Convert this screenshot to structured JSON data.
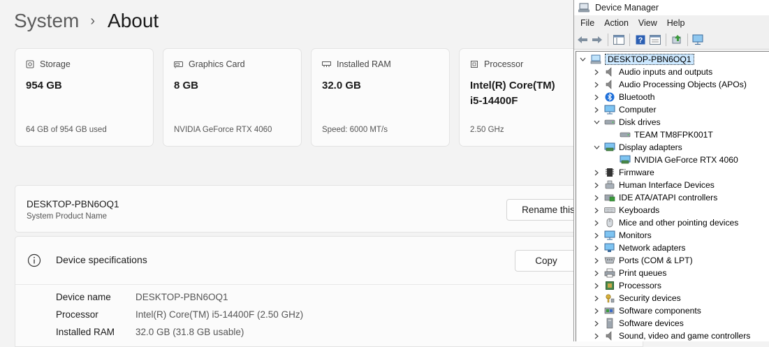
{
  "settings": {
    "breadcrumb": {
      "parent": "System",
      "separator": "›",
      "current": "About"
    },
    "cards": [
      {
        "title": "Storage",
        "value": "954 GB",
        "sub": "64 GB of 954 GB used",
        "icon": "storage-icon"
      },
      {
        "title": "Graphics Card",
        "value": "8 GB",
        "sub": "NVIDIA GeForce RTX 4060",
        "icon": "graphics-card-icon"
      },
      {
        "title": "Installed RAM",
        "value": "32.0 GB",
        "sub": "Speed: 6000 MT/s",
        "icon": "ram-icon"
      },
      {
        "title": "Processor",
        "value_line1": "Intel(R) Core(TM)",
        "value_line2": "i5-14400F",
        "sub": "2.50 GHz",
        "icon": "processor-icon"
      }
    ],
    "pc": {
      "name": "DESKTOP-PBN6OQ1",
      "sub": "System Product Name",
      "rename_label": "Rename this"
    },
    "specs": {
      "title": "Device specifications",
      "copy_label": "Copy",
      "rows": [
        {
          "label": "Device name",
          "value": "DESKTOP-PBN6OQ1"
        },
        {
          "label": "Processor",
          "value": "Intel(R) Core(TM) i5-14400F (2.50 GHz)"
        },
        {
          "label": "Installed RAM",
          "value": "32.0 GB (31.8 GB usable)"
        }
      ]
    }
  },
  "device_manager": {
    "title": "Device Manager",
    "menu": [
      "File",
      "Action",
      "View",
      "Help"
    ],
    "root": "DESKTOP-PBN6OQ1",
    "nodes": [
      {
        "label": "Audio inputs and outputs",
        "expanded": false,
        "icon": "speaker-icon"
      },
      {
        "label": "Audio Processing Objects (APOs)",
        "expanded": false,
        "icon": "speaker-icon"
      },
      {
        "label": "Bluetooth",
        "expanded": false,
        "icon": "bluetooth-icon"
      },
      {
        "label": "Computer",
        "expanded": false,
        "icon": "monitor-icon"
      },
      {
        "label": "Disk drives",
        "expanded": true,
        "icon": "disk-icon",
        "children": [
          "TEAM TM8FPK001T"
        ]
      },
      {
        "label": "Display adapters",
        "expanded": true,
        "icon": "display-adapter-icon",
        "children": [
          "NVIDIA GeForce RTX 4060"
        ]
      },
      {
        "label": "Firmware",
        "expanded": false,
        "icon": "chip-icon"
      },
      {
        "label": "Human Interface Devices",
        "expanded": false,
        "icon": "hid-icon"
      },
      {
        "label": "IDE ATA/ATAPI controllers",
        "expanded": false,
        "icon": "controller-icon"
      },
      {
        "label": "Keyboards",
        "expanded": false,
        "icon": "keyboard-icon"
      },
      {
        "label": "Mice and other pointing devices",
        "expanded": false,
        "icon": "mouse-icon"
      },
      {
        "label": "Monitors",
        "expanded": false,
        "icon": "monitor-icon"
      },
      {
        "label": "Network adapters",
        "expanded": false,
        "icon": "network-icon"
      },
      {
        "label": "Ports (COM & LPT)",
        "expanded": false,
        "icon": "port-icon"
      },
      {
        "label": "Print queues",
        "expanded": false,
        "icon": "printer-icon"
      },
      {
        "label": "Processors",
        "expanded": false,
        "icon": "processor-icon"
      },
      {
        "label": "Security devices",
        "expanded": false,
        "icon": "security-key-icon"
      },
      {
        "label": "Software components",
        "expanded": false,
        "icon": "software-component-icon"
      },
      {
        "label": "Software devices",
        "expanded": false,
        "icon": "software-device-icon"
      },
      {
        "label": "Sound, video and game controllers",
        "expanded": false,
        "icon": "speaker-icon"
      }
    ]
  }
}
